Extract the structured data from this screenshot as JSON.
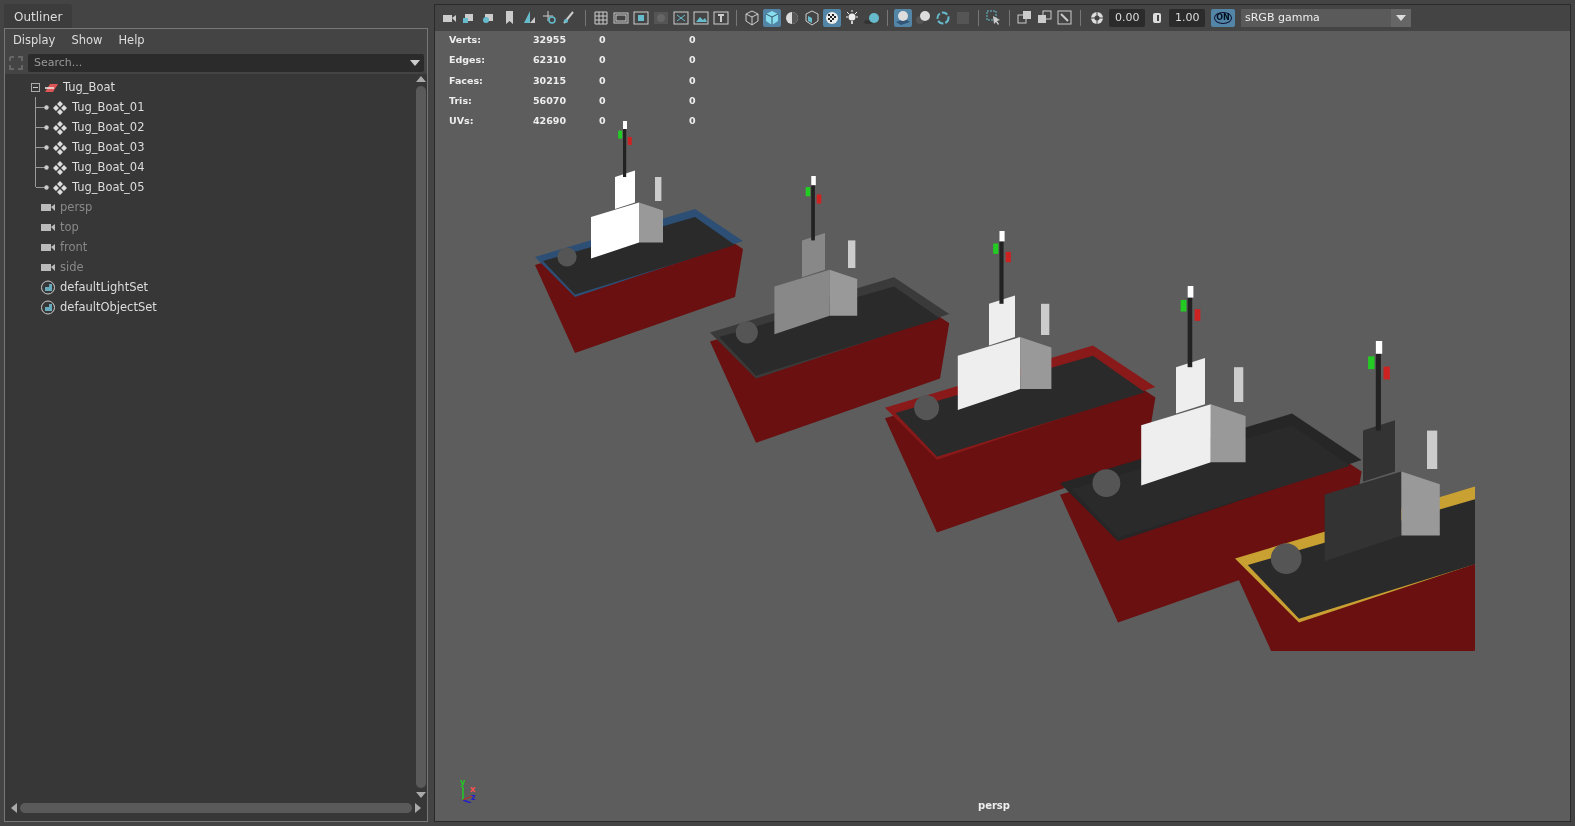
{
  "outliner": {
    "tab": "Outliner",
    "menu": [
      "Display",
      "Show",
      "Help"
    ],
    "search": {
      "placeholder": "Search..."
    },
    "tree": [
      {
        "label": "Tug_Boat",
        "kind": "group",
        "expanded": true,
        "dimmed": false,
        "children": [
          {
            "label": "Tug_Boat_01",
            "kind": "mesh",
            "dimmed": false
          },
          {
            "label": "Tug_Boat_02",
            "kind": "mesh",
            "dimmed": false
          },
          {
            "label": "Tug_Boat_03",
            "kind": "mesh",
            "dimmed": false
          },
          {
            "label": "Tug_Boat_04",
            "kind": "mesh",
            "dimmed": false
          },
          {
            "label": "Tug_Boat_05",
            "kind": "mesh",
            "dimmed": false
          }
        ]
      },
      {
        "label": "persp",
        "kind": "camera",
        "dimmed": true
      },
      {
        "label": "top",
        "kind": "camera",
        "dimmed": true
      },
      {
        "label": "front",
        "kind": "camera",
        "dimmed": true
      },
      {
        "label": "side",
        "kind": "camera",
        "dimmed": true
      },
      {
        "label": "defaultLightSet",
        "kind": "set",
        "dimmed": false
      },
      {
        "label": "defaultObjectSet",
        "kind": "set",
        "dimmed": false
      }
    ]
  },
  "toolbar": {
    "toggles": [
      {
        "selected": false
      },
      {
        "selected": false
      },
      {
        "selected": false
      },
      {
        "selected": false
      },
      {
        "selected": false
      },
      {
        "selected": false
      },
      {
        "selected": false
      },
      {
        "selected": false
      },
      {
        "selected": false
      },
      {
        "selected": false
      },
      {
        "selected": false
      },
      {
        "selected": false
      },
      {
        "selected": false
      },
      {
        "selected": false
      },
      {
        "selected": false
      },
      {
        "selected": true
      },
      {
        "selected": false
      },
      {
        "selected": false
      },
      {
        "selected": true
      },
      {
        "selected": false
      },
      {
        "selected": false
      },
      {
        "selected": true
      },
      {
        "selected": false
      },
      {
        "selected": false
      },
      {
        "selected": false
      },
      {
        "selected": false
      },
      {
        "selected": false
      },
      {
        "selected": false
      },
      {
        "selected": false
      }
    ],
    "exposure": "0.00",
    "gamma": "1.00",
    "color_management_on": true,
    "color_management_label": "ON",
    "view_transform": "sRGB gamma"
  },
  "stats": [
    {
      "label": "Verts:",
      "values": [
        "32955",
        "0",
        "0"
      ]
    },
    {
      "label": "Edges:",
      "values": [
        "62310",
        "0",
        "0"
      ]
    },
    {
      "label": "Faces:",
      "values": [
        "30215",
        "0",
        "0"
      ]
    },
    {
      "label": "Tris:",
      "values": [
        "56070",
        "0",
        "0"
      ]
    },
    {
      "label": "UVs:",
      "values": [
        "42690",
        "0",
        "0"
      ]
    }
  ],
  "axis": {
    "y": "y",
    "x": "x",
    "z": "z"
  },
  "camera_label": "persp"
}
